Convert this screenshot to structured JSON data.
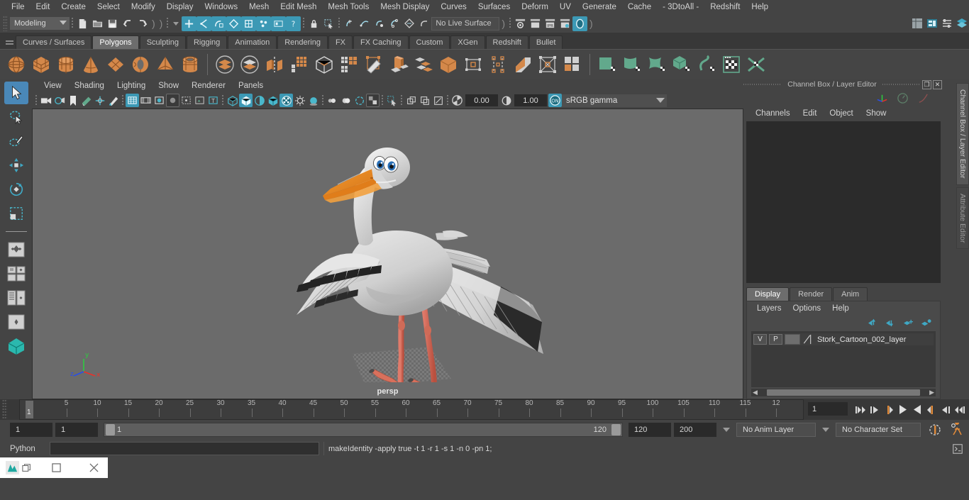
{
  "menubar": {
    "items": [
      "File",
      "Edit",
      "Create",
      "Select",
      "Modify",
      "Display",
      "Windows",
      "Mesh",
      "Edit Mesh",
      "Mesh Tools",
      "Mesh Display",
      "Curves",
      "Surfaces",
      "Deform",
      "UV",
      "Generate",
      "Cache",
      "- 3DtoAll -",
      "Redshift",
      "Help"
    ]
  },
  "statusline": {
    "mode": "Modeling",
    "live_surface": "No Live Surface",
    "icons": [
      "new-scene-icon",
      "open-scene-icon",
      "save-scene-icon",
      "undo-icon",
      "redo-icon",
      "select-by-hierarchy-icon",
      "select-by-component-icon",
      "select-by-object-icon",
      "select-mask-mesh-icon",
      "select-mask-nurbs-icon",
      "select-mask-deform-icon",
      "select-mask-misc-icon",
      "lock-selection-icon",
      "highlight-selection-icon",
      "snap-grid-icon",
      "snap-curve-icon",
      "snap-point-icon",
      "snap-projected-icon",
      "snap-view-plane-icon",
      "snap-make-live-icon",
      "render-current-frame-icon",
      "render-sequence-icon",
      "ipr-render-icon",
      "render-settings-icon",
      "hypershade-icon",
      "show-hide-editors-icon",
      "attribute-editor-toggle-icon",
      "tool-settings-toggle-icon",
      "channel-box-toggle-icon"
    ]
  },
  "shelf": {
    "tabs": [
      "Curves / Surfaces",
      "Polygons",
      "Sculpting",
      "Rigging",
      "Animation",
      "Rendering",
      "FX",
      "FX Caching",
      "Custom",
      "XGen",
      "Redshift",
      "Bullet"
    ],
    "active_tab": "Polygons",
    "buttons": [
      {
        "name": "poly-sphere-icon",
        "kind": "prim"
      },
      {
        "name": "poly-cube-icon",
        "kind": "prim"
      },
      {
        "name": "poly-cylinder-icon",
        "kind": "prim"
      },
      {
        "name": "poly-cone-icon",
        "kind": "prim"
      },
      {
        "name": "poly-plane-icon",
        "kind": "prim"
      },
      {
        "name": "poly-torus-icon",
        "kind": "prim"
      },
      {
        "name": "poly-pyramid-icon",
        "kind": "prim"
      },
      {
        "name": "poly-pipe-icon",
        "kind": "prim"
      },
      {
        "name": "boolean-union-icon",
        "kind": "bool"
      },
      {
        "name": "boolean-difference-icon",
        "kind": "bool"
      },
      {
        "name": "mirror-geometry-icon",
        "kind": "mirror"
      },
      {
        "name": "combine-icon",
        "kind": "grey"
      },
      {
        "name": "smooth-icon",
        "kind": "grey"
      },
      {
        "name": "separate-icon",
        "kind": "grey"
      },
      {
        "name": "multi-cut-icon",
        "kind": "grey"
      },
      {
        "name": "extrude-icon",
        "kind": "grey"
      },
      {
        "name": "bevel-icon",
        "kind": "grey"
      },
      {
        "name": "bridge-icon",
        "kind": "grey"
      },
      {
        "name": "fill-hole-icon",
        "kind": "grey"
      },
      {
        "name": "append-polygon-icon",
        "kind": "grey"
      },
      {
        "name": "wedge-icon",
        "kind": "grey"
      },
      {
        "name": "poke-face-icon",
        "kind": "grey"
      },
      {
        "name": "quad-draw-icon",
        "kind": "grey"
      },
      {
        "name": "uv-planar-icon",
        "kind": "green"
      },
      {
        "name": "uv-cylindrical-icon",
        "kind": "green"
      },
      {
        "name": "uv-spherical-icon",
        "kind": "green"
      },
      {
        "name": "uv-automatic-icon",
        "kind": "green"
      },
      {
        "name": "uv-unfold-icon",
        "kind": "green"
      },
      {
        "name": "uv-editor-icon",
        "kind": "green"
      },
      {
        "name": "uv-cut-sew-icon",
        "kind": "green"
      }
    ]
  },
  "toolbox": {
    "items": [
      {
        "name": "select-tool",
        "selected": true
      },
      {
        "name": "lasso-select-tool",
        "selected": false
      },
      {
        "name": "paint-select-tool",
        "selected": false
      },
      {
        "name": "move-tool",
        "selected": false
      },
      {
        "name": "rotate-tool",
        "selected": false
      },
      {
        "name": "scale-tool",
        "selected": false
      },
      {
        "name": "last-tool-used",
        "selected": false
      },
      {
        "name": "single-perspective-layout",
        "selected": false
      },
      {
        "name": "four-view-layout",
        "selected": false
      },
      {
        "name": "outliner-persp-layout",
        "selected": false
      },
      {
        "name": "persp-graph-layout",
        "selected": false
      },
      {
        "name": "bookmark-layout",
        "selected": false
      }
    ]
  },
  "viewport": {
    "menus": [
      "View",
      "Shading",
      "Lighting",
      "Show",
      "Renderer",
      "Panels"
    ],
    "camera_label": "persp",
    "exposure": "0.00",
    "gamma": "1.00",
    "color_management": "sRGB gamma",
    "axis_labels": {
      "x": "x",
      "y": "y",
      "z": "z"
    },
    "toolbar_icons": [
      "select-camera-icon",
      "camera-attributes-icon",
      "bookmark-icon",
      "image-plane-icon",
      "2d-pan-zoom-icon",
      "grease-pencil-icon",
      "grid-toggle-icon",
      "film-gate-icon",
      "resolution-gate-icon",
      "gate-mask-icon",
      "film-origin-icon",
      "safe-action-icon",
      "title-safe-icon",
      "wireframe-icon",
      "smooth-shade-icon",
      "shaded-wireframe-icon",
      "textured-icon",
      "use-all-lights-icon",
      "shadows-icon",
      "ambient-occlusion-icon",
      "motion-blur-icon",
      "multisample-icon",
      "depth-of-field-icon",
      "isolate-select-icon",
      "xray-icon",
      "xray-joints-icon",
      "xray-active-components-icon",
      "exposure-icon",
      "gamma-icon",
      "color-management-icon"
    ]
  },
  "channel_box": {
    "title": "Channel Box / Layer Editor",
    "menus": [
      "Channels",
      "Edit",
      "Object",
      "Show"
    ],
    "window_buttons": [
      "restore-icon",
      "close-icon"
    ],
    "header_icons": [
      "manipulator-icon",
      "speed-icon",
      "curve-icon"
    ]
  },
  "layer_editor": {
    "tabs": [
      "Display",
      "Render",
      "Anim"
    ],
    "active_tab": "Display",
    "menus": [
      "Layers",
      "Options",
      "Help"
    ],
    "buttons": [
      "move-layer-up-icon",
      "move-layer-down-icon",
      "new-layer-icon",
      "new-layer-from-selected-icon"
    ],
    "layers": [
      {
        "visibility": "V",
        "playback": "P",
        "color": "",
        "name": "Stork_Cartoon_002_layer"
      }
    ]
  },
  "side_tabs": [
    {
      "label": "Channel Box / Layer Editor",
      "active": true
    },
    {
      "label": "Attribute Editor",
      "active": false
    }
  ],
  "timeline": {
    "current_frame": "1",
    "tick_labels": [
      "5",
      "10",
      "15",
      "20",
      "25",
      "30",
      "35",
      "40",
      "45",
      "50",
      "55",
      "60",
      "65",
      "70",
      "75",
      "80",
      "85",
      "90",
      "95",
      "100",
      "105",
      "110",
      "115",
      "12"
    ],
    "frame_field": "1",
    "playback_buttons": [
      "go-to-start-icon",
      "step-back-key-icon",
      "step-back-frame-icon",
      "play-backwards-icon",
      "play-forwards-icon",
      "step-forward-frame-icon",
      "step-forward-key-icon",
      "go-to-end-icon"
    ]
  },
  "range": {
    "start_field": "1",
    "range_start_field": "1",
    "slider_min_label": "1",
    "slider_max_label": "120",
    "range_end_field": "120",
    "end_field": "200",
    "anim_layer": "No Anim Layer",
    "character_set": "No Character Set",
    "right_icons": [
      "auto-keyframe-icon",
      "animation-preferences-icon"
    ]
  },
  "command_line": {
    "language_label": "Python",
    "input_value": "",
    "output_text": "makeIdentity -apply true -t 1 -r 1 -s 1 -n 0 -pn 1;",
    "script-editor-icon": "script-editor-icon"
  },
  "taskbar": {
    "window_controls": [
      "app-icon",
      "restore-window-icon",
      "maximize-window-icon",
      "close-window-icon"
    ]
  },
  "colors": {
    "accent_blue": "#3c99b5",
    "selection_blue": "#4a88b8",
    "shelf_orange": "#d4884a",
    "shelf_green": "#62a98c",
    "background": "#444444",
    "viewport_bg": "#6b6b6b",
    "panel_dark": "#2b2b2b"
  }
}
